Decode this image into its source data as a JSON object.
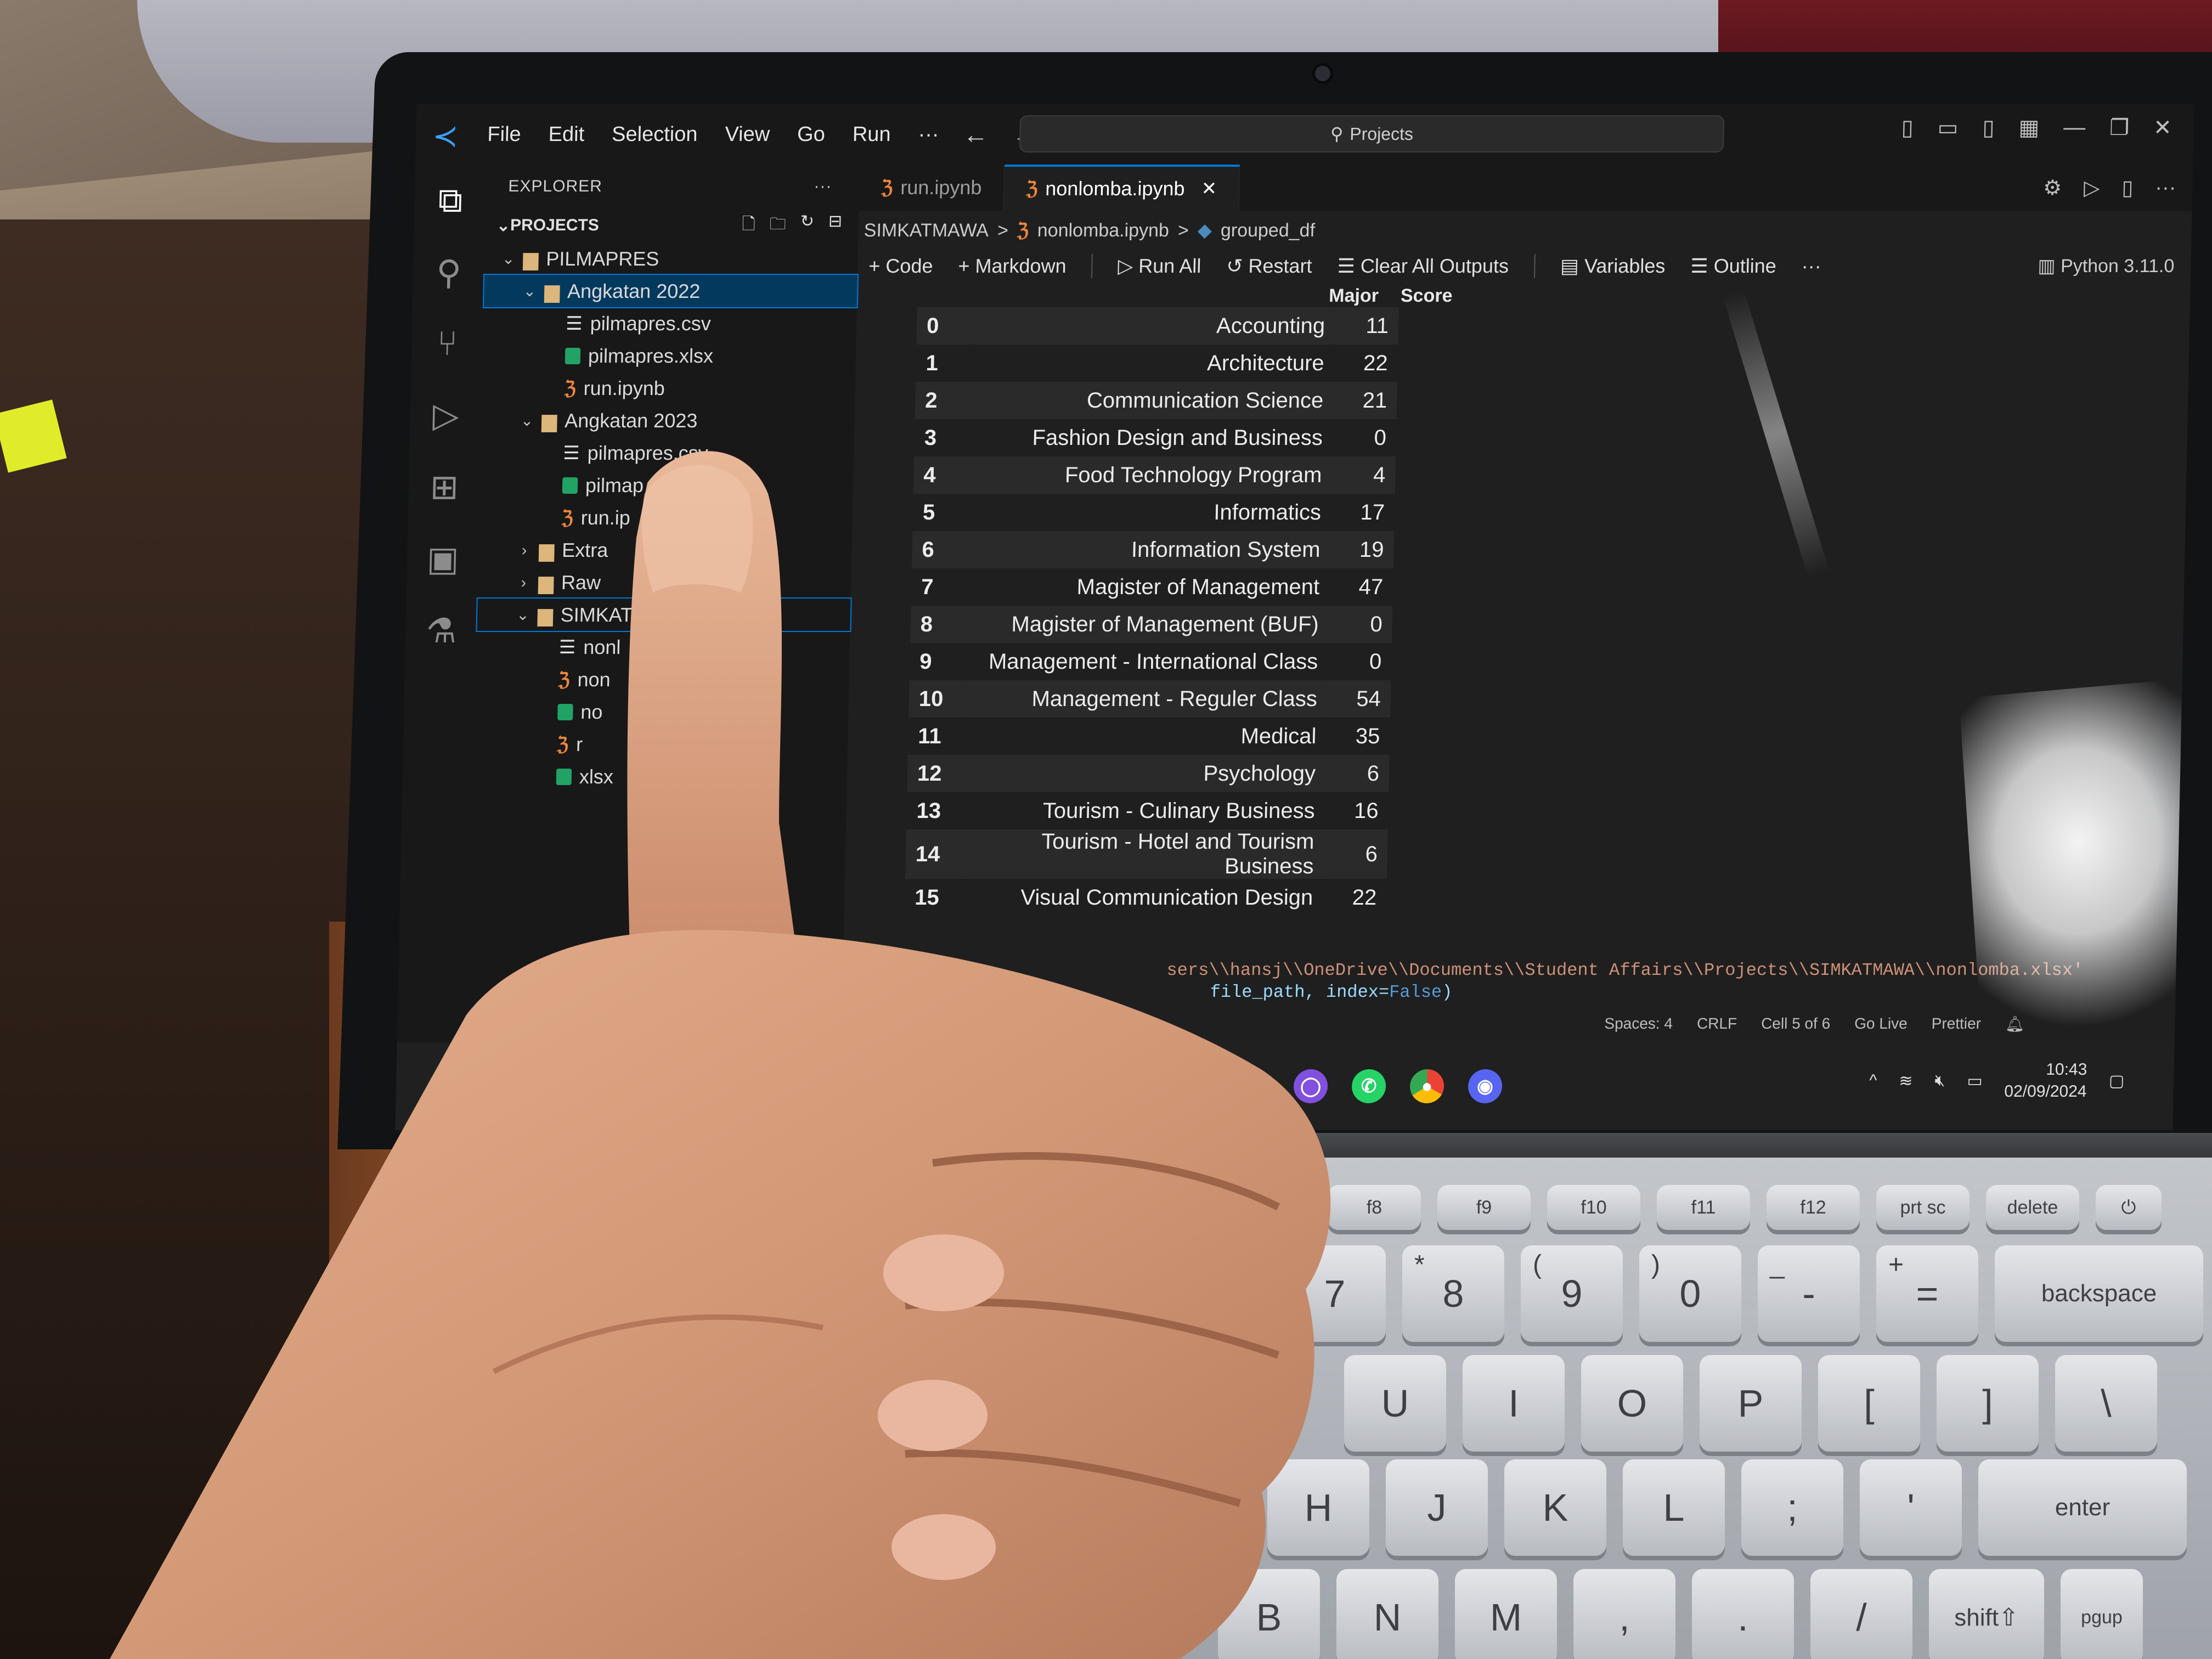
{
  "vscode": {
    "menu": [
      "File",
      "Edit",
      "Selection",
      "View",
      "Go",
      "Run",
      "···"
    ],
    "search_label": "Projects",
    "explorer_title": "EXPLORER",
    "section_title": "PROJECTS",
    "tree": [
      {
        "label": "PILMAPRES",
        "type": "folder",
        "depth": 0
      },
      {
        "label": "Angkatan 2022",
        "type": "folder",
        "depth": 1,
        "selected": true
      },
      {
        "label": "pilmapres.csv",
        "type": "csv",
        "depth": 2
      },
      {
        "label": "pilmapres.xlsx",
        "type": "xlsx",
        "depth": 2
      },
      {
        "label": "run.ipynb",
        "type": "nb",
        "depth": 2
      },
      {
        "label": "Angkatan 2023",
        "type": "folder",
        "depth": 1
      },
      {
        "label": "pilmapres.csv",
        "type": "csv",
        "depth": 2
      },
      {
        "label": "pilmap",
        "type": "xlsx",
        "depth": 2
      },
      {
        "label": "run.ip",
        "type": "nb",
        "depth": 2
      },
      {
        "label": "Extra",
        "type": "folder-closed",
        "depth": 1
      },
      {
        "label": "Raw",
        "type": "folder-closed",
        "depth": 1
      },
      {
        "label": "SIMKAT",
        "type": "folder",
        "depth": 1,
        "focused": true
      },
      {
        "label": "nonl",
        "type": "csv",
        "depth": 2
      },
      {
        "label": "non",
        "type": "nb",
        "depth": 2
      },
      {
        "label": "no",
        "type": "xlsx",
        "depth": 2
      },
      {
        "label": "r",
        "type": "nb",
        "depth": 2
      },
      {
        "label": "xlsx",
        "type": "xlsx",
        "depth": 2
      }
    ],
    "tabs": [
      {
        "label": "run.ipynb",
        "active": false
      },
      {
        "label": "nonlomba.ipynb",
        "active": true
      }
    ],
    "breadcrumb": [
      "SIMKATMAWA",
      ">",
      "nonlomba.ipynb",
      ">",
      "grouped_df"
    ],
    "toolbar": {
      "code": "Code",
      "markdown": "Markdown",
      "run_all": "Run All",
      "restart": "Restart",
      "clear": "Clear All Outputs",
      "variables": "Variables",
      "outline": "Outline",
      "more": "···",
      "kernel": "Python 3.11.0"
    },
    "df_headers": {
      "major": "Major",
      "score": "Score"
    },
    "df_rows": [
      {
        "idx": "0",
        "major": "Accounting",
        "score": "11"
      },
      {
        "idx": "1",
        "major": "Architecture",
        "score": "22"
      },
      {
        "idx": "2",
        "major": "Communication Science",
        "score": "21"
      },
      {
        "idx": "3",
        "major": "Fashion Design and Business",
        "score": "0"
      },
      {
        "idx": "4",
        "major": "Food Technology Program",
        "score": "4"
      },
      {
        "idx": "5",
        "major": "Informatics",
        "score": "17"
      },
      {
        "idx": "6",
        "major": "Information System",
        "score": "19"
      },
      {
        "idx": "7",
        "major": "Magister of Management",
        "score": "47"
      },
      {
        "idx": "8",
        "major": "Magister of Management (BUF)",
        "score": "0"
      },
      {
        "idx": "9",
        "major": "Management - International Class",
        "score": "0"
      },
      {
        "idx": "10",
        "major": "Management - Reguler Class",
        "score": "54"
      },
      {
        "idx": "11",
        "major": "Medical",
        "score": "35"
      },
      {
        "idx": "12",
        "major": "Psychology",
        "score": "6"
      },
      {
        "idx": "13",
        "major": "Tourism - Culinary Business",
        "score": "16"
      },
      {
        "idx": "14",
        "major": "Tourism - Hotel and Tourism Business",
        "score": "6"
      },
      {
        "idx": "15",
        "major": "Visual Communication Design",
        "score": "22"
      }
    ],
    "code_line1": "sers\\\\hansj\\\\OneDrive\\\\Documents\\\\Student Affairs\\\\Projects\\\\SIMKATMAWA\\\\nonlomba.xlsx'",
    "code_line2_a": "file_path, index=",
    "code_line2_kw": "False",
    "code_line2_b": ")",
    "status": [
      "Spaces: 4",
      "CRLF",
      "Cell 5 of 6",
      "Go Live",
      "Prettier"
    ],
    "clock_time": "10:43",
    "clock_date": "02/09/2024"
  },
  "keyboard": {
    "fn_row": [
      "f8",
      "f9",
      "f10",
      "f11",
      "f12",
      "prt sc",
      "delete"
    ],
    "num_row": [
      {
        "main": "7",
        "alt": ""
      },
      {
        "main": "8",
        "alt": "*"
      },
      {
        "main": "9",
        "alt": "("
      },
      {
        "main": "0",
        "alt": ")"
      },
      {
        "main": "-",
        "alt": "_"
      },
      {
        "main": "=",
        "alt": "+"
      }
    ],
    "backspace": "backspace",
    "top_row": [
      "U",
      "I",
      "O",
      "P",
      "[",
      "]",
      "\\"
    ],
    "home_row": [
      "H",
      "J",
      "K",
      "L",
      ";",
      "'"
    ],
    "enter": "enter",
    "bottom_row": [
      "B",
      "N",
      "M",
      ",",
      ".",
      "/"
    ],
    "shift": "shift⇧",
    "pgup": "pgup"
  },
  "colors": {
    "accent": "#0078d4",
    "notebook_icon": "#f0863a",
    "folder": "#dcb67a"
  }
}
